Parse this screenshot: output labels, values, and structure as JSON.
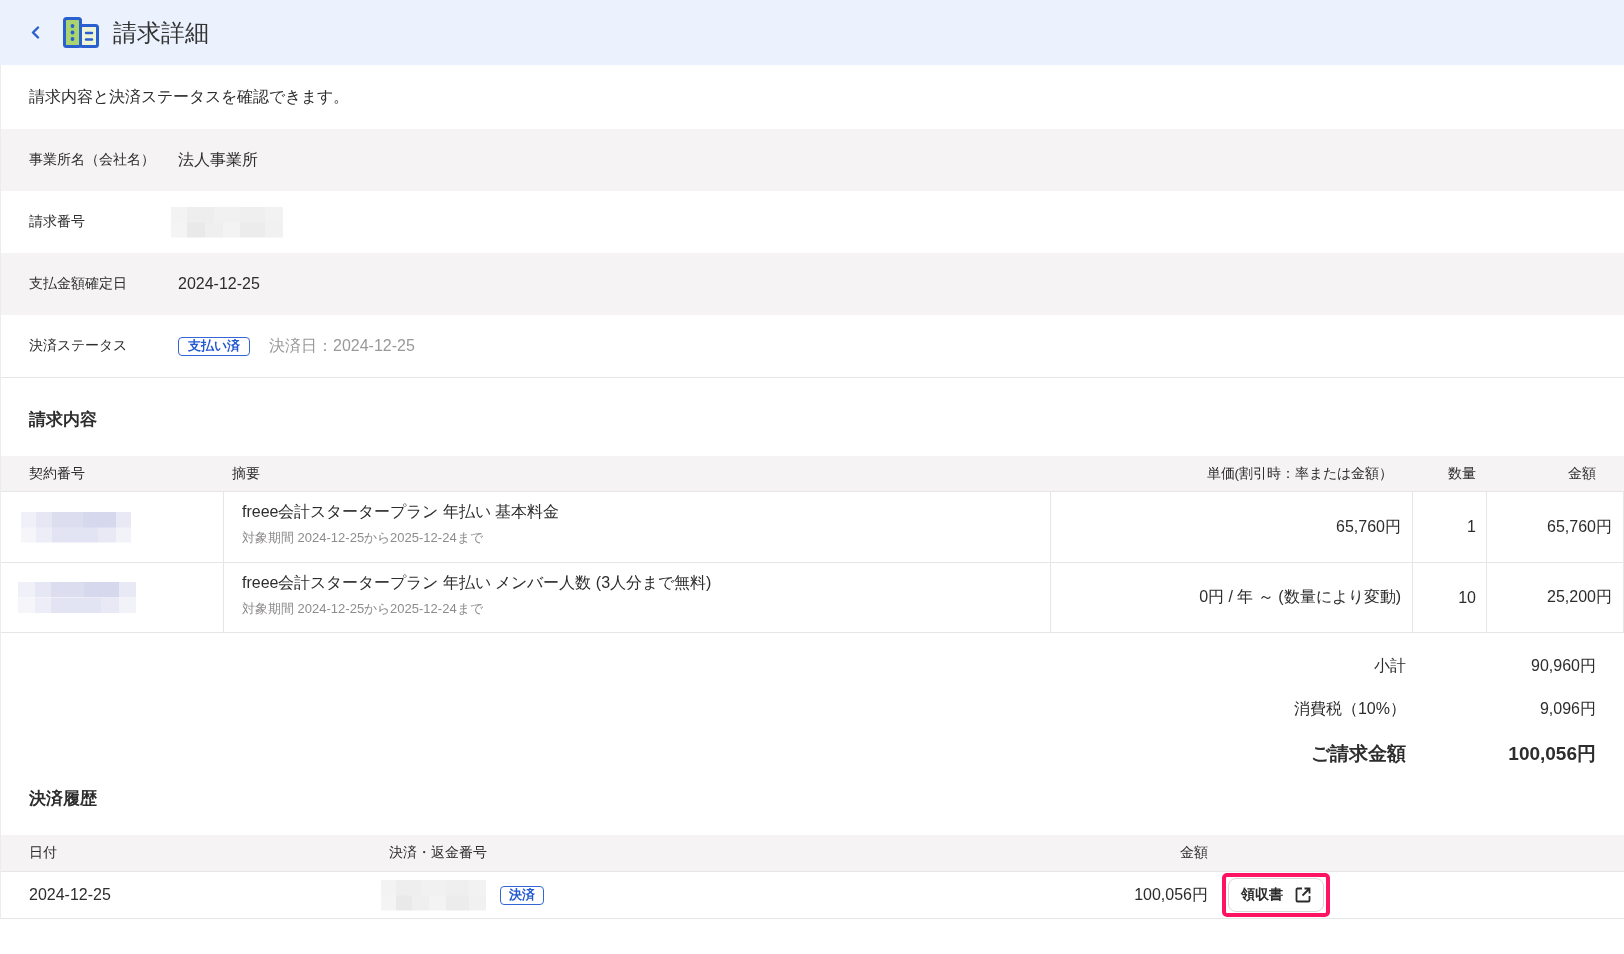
{
  "header": {
    "title": "請求詳細"
  },
  "description": "請求内容と決済ステータスを確認できます。",
  "details": [
    {
      "label": "事業所名（会社名）",
      "kind": "text",
      "value": "法人事業所"
    },
    {
      "label": "請求番号",
      "kind": "redacted"
    },
    {
      "label": "支払金額確定日",
      "kind": "text",
      "value": "2024-12-25"
    },
    {
      "label": "決済ステータス",
      "kind": "status",
      "badge": "支払い済",
      "note": "決済日：2024-12-25"
    }
  ],
  "invoice": {
    "title": "請求内容",
    "columns": [
      "契約番号",
      "摘要",
      "単価(割引時：率または金額）",
      "数量",
      "金額"
    ],
    "rows": [
      {
        "summary": "freee会計スタータープラン 年払い 基本料金",
        "period": "対象期間 2024-12-25から2025-12-24まで",
        "unit_price": "65,760円",
        "quantity": "1",
        "amount": "65,760円"
      },
      {
        "summary": "freee会計スタータープラン 年払い メンバー人数 (3人分まで無料)",
        "period": "対象期間 2024-12-25から2025-12-24まで",
        "unit_price": "0円 / 年 ～ (数量により変動)",
        "quantity": "10",
        "amount": "25,200円"
      }
    ],
    "totals": [
      {
        "kind": "normal",
        "label": "小計",
        "value": "90,960円"
      },
      {
        "kind": "normal",
        "label": "消費税（10%）",
        "value": "9,096円"
      },
      {
        "kind": "grand",
        "label": "ご請求金額",
        "value": "100,056円"
      }
    ]
  },
  "history": {
    "title": "決済履歴",
    "columns": [
      "日付",
      "決済・返金番号",
      "金額"
    ],
    "rows": [
      {
        "date": "2024-12-25",
        "tag": "決済",
        "amount": "100,056円",
        "receipt": {
          "label": "領収書",
          "highlighted": true
        }
      }
    ]
  }
}
